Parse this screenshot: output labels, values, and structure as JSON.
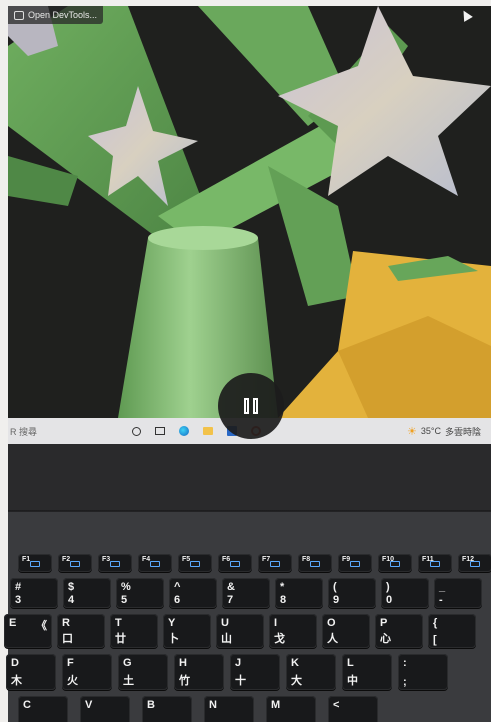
{
  "screen": {
    "devtools_label": "Open DevTools..."
  },
  "taskbar": {
    "search_text": "R 搜尋",
    "temperature": "35°C",
    "weather_text": "多雲時陰"
  },
  "fkeys": [
    {
      "label": "F1"
    },
    {
      "label": "F2"
    },
    {
      "label": "F3"
    },
    {
      "label": "F4"
    },
    {
      "label": "F5"
    },
    {
      "label": "F6"
    },
    {
      "label": "F7"
    },
    {
      "label": "F8"
    },
    {
      "label": "F9"
    },
    {
      "label": "F10"
    },
    {
      "label": "F11"
    },
    {
      "label": "F12"
    }
  ],
  "row_numbers": [
    {
      "p": "#",
      "s": "",
      "q": "3",
      "r": ""
    },
    {
      "p": "$",
      "s": "",
      "q": "4",
      "r": ""
    },
    {
      "p": "%",
      "s": "",
      "q": "5",
      "r": ""
    },
    {
      "p": "^",
      "s": "",
      "q": "6",
      "r": ""
    },
    {
      "p": "&",
      "s": "",
      "q": "7",
      "r": ""
    },
    {
      "p": "*",
      "s": "",
      "q": "8",
      "r": ""
    },
    {
      "p": "(",
      "s": "",
      "q": "9",
      "r": ""
    },
    {
      "p": ")",
      "s": "",
      "q": "0",
      "r": ""
    },
    {
      "p": "_",
      "s": "",
      "q": "-",
      "r": ""
    }
  ],
  "row_qwerty": [
    {
      "p": "E",
      "s": "《",
      "q": "",
      "r": ""
    },
    {
      "p": "R",
      "s": "",
      "q": "口",
      "r": ""
    },
    {
      "p": "T",
      "s": "",
      "q": "廿",
      "r": ""
    },
    {
      "p": "Y",
      "s": "",
      "q": "卜",
      "r": ""
    },
    {
      "p": "U",
      "s": "",
      "q": "山",
      "r": ""
    },
    {
      "p": "I",
      "s": "",
      "q": "戈",
      "r": ""
    },
    {
      "p": "O",
      "s": "",
      "q": "人",
      "r": ""
    },
    {
      "p": "P",
      "s": "",
      "q": "心",
      "r": ""
    },
    {
      "p": "{",
      "s": "",
      "q": "[",
      "r": ""
    }
  ],
  "row_asdf": [
    {
      "p": "D",
      "s": "",
      "q": "木",
      "r": ""
    },
    {
      "p": "F",
      "s": "",
      "q": "火",
      "r": ""
    },
    {
      "p": "G",
      "s": "",
      "q": "土",
      "r": ""
    },
    {
      "p": "H",
      "s": "",
      "q": "竹",
      "r": ""
    },
    {
      "p": "J",
      "s": "",
      "q": "十",
      "r": ""
    },
    {
      "p": "K",
      "s": "",
      "q": "大",
      "r": ""
    },
    {
      "p": "L",
      "s": "",
      "q": "中",
      "r": ""
    },
    {
      "p": ":",
      "s": "",
      "q": ";",
      "r": ""
    }
  ],
  "row_zxcv": [
    {
      "p": "C",
      "s": "",
      "q": "",
      "r": ""
    },
    {
      "p": "V",
      "s": "",
      "q": "",
      "r": ""
    },
    {
      "p": "B",
      "s": "",
      "q": "",
      "r": ""
    },
    {
      "p": "N",
      "s": "",
      "q": "",
      "r": ""
    },
    {
      "p": "M",
      "s": "",
      "q": "",
      "r": ""
    },
    {
      "p": "<",
      "s": "",
      "q": "",
      "r": ""
    }
  ],
  "colors": {
    "scene_green": "#7dbb6e",
    "star_yellow": "#e3b23c",
    "taskbar": "#e4e4e6",
    "key": "#18191b"
  }
}
